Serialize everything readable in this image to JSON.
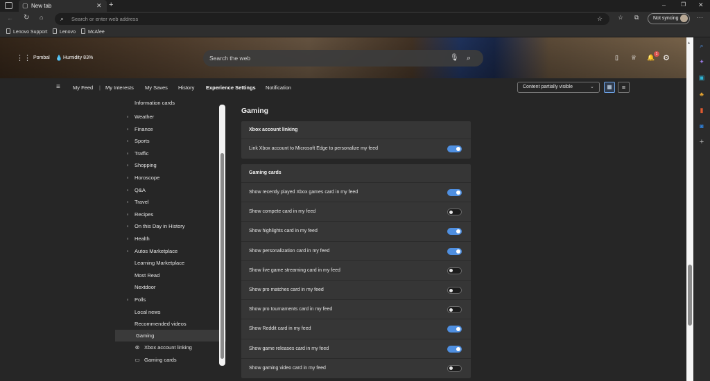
{
  "tab": {
    "title": "New tab"
  },
  "address": {
    "placeholder": "Search or enter web address"
  },
  "profile": {
    "sync_label": "Not syncing"
  },
  "favorites": [
    "Lenovo Support",
    "Lenovo",
    "McAfee"
  ],
  "weather": {
    "location": "Pombal",
    "humidity": "Humidity 83%"
  },
  "search": {
    "placeholder": "Search the web"
  },
  "notifications": {
    "count": "1"
  },
  "nav": {
    "items": [
      "My Feed",
      "|",
      "My Interests",
      "My Saves",
      "History",
      "Experience Settings",
      "Notification"
    ],
    "active": "Experience Settings",
    "dropdown_value": "Content partially visible"
  },
  "sidebar": {
    "partial_top": "Information cards",
    "items": [
      {
        "label": "Weather",
        "icon": "cloud-sun-icon"
      },
      {
        "label": "Finance",
        "icon": "chart-line-icon"
      },
      {
        "label": "Sports",
        "icon": "trophy-icon"
      },
      {
        "label": "Traffic",
        "icon": "traffic-icon"
      },
      {
        "label": "Shopping",
        "icon": "tag-icon"
      },
      {
        "label": "Horoscope",
        "icon": "zodiac-icon"
      },
      {
        "label": "Q&A",
        "icon": "question-icon"
      },
      {
        "label": "Travel",
        "icon": "airplane-icon"
      },
      {
        "label": "Recipes",
        "icon": "recipe-icon"
      },
      {
        "label": "On this Day in History",
        "icon": "calendar-icon"
      },
      {
        "label": "Health",
        "icon": "heart-icon"
      },
      {
        "label": "Autos Marketplace",
        "icon": "car-icon"
      },
      {
        "label": "Learning Marketplace",
        "icon": ""
      },
      {
        "label": "Most Read",
        "icon": ""
      },
      {
        "label": "Nextdoor",
        "icon": ""
      },
      {
        "label": "Polls",
        "icon": "poll-icon"
      },
      {
        "label": "Local news",
        "icon": ""
      },
      {
        "label": "Recommended videos",
        "icon": ""
      }
    ],
    "gaming": {
      "label": "Gaming",
      "children": [
        "Xbox account linking",
        "Gaming cards"
      ]
    }
  },
  "content": {
    "title": "Gaming",
    "xbox_card": {
      "header": "Xbox account linking",
      "rows": [
        {
          "label": "Link Xbox account to Microsoft Edge to personalize my feed",
          "on": true
        }
      ]
    },
    "gaming_card": {
      "header": "Gaming cards",
      "rows": [
        {
          "label": "Show recently played Xbox games card in my feed",
          "on": true
        },
        {
          "label": "Show compete card in my feed",
          "on": false
        },
        {
          "label": "Show highlights card in my feed",
          "on": true
        },
        {
          "label": "Show personalization card in my feed",
          "on": true
        },
        {
          "label": "Show live game streaming card in my feed",
          "on": false
        },
        {
          "label": "Show pro matches card in my feed",
          "on": false
        },
        {
          "label": "Show pro tournaments card in my feed",
          "on": false
        },
        {
          "label": "Show Reddit card in my feed",
          "on": true
        },
        {
          "label": "Show game releases card in my feed",
          "on": true
        },
        {
          "label": "Show gaming video card in my feed",
          "on": false
        }
      ]
    }
  },
  "colors": {
    "accent": "#4f8fe0",
    "background": "#262626",
    "card": "#363636"
  }
}
